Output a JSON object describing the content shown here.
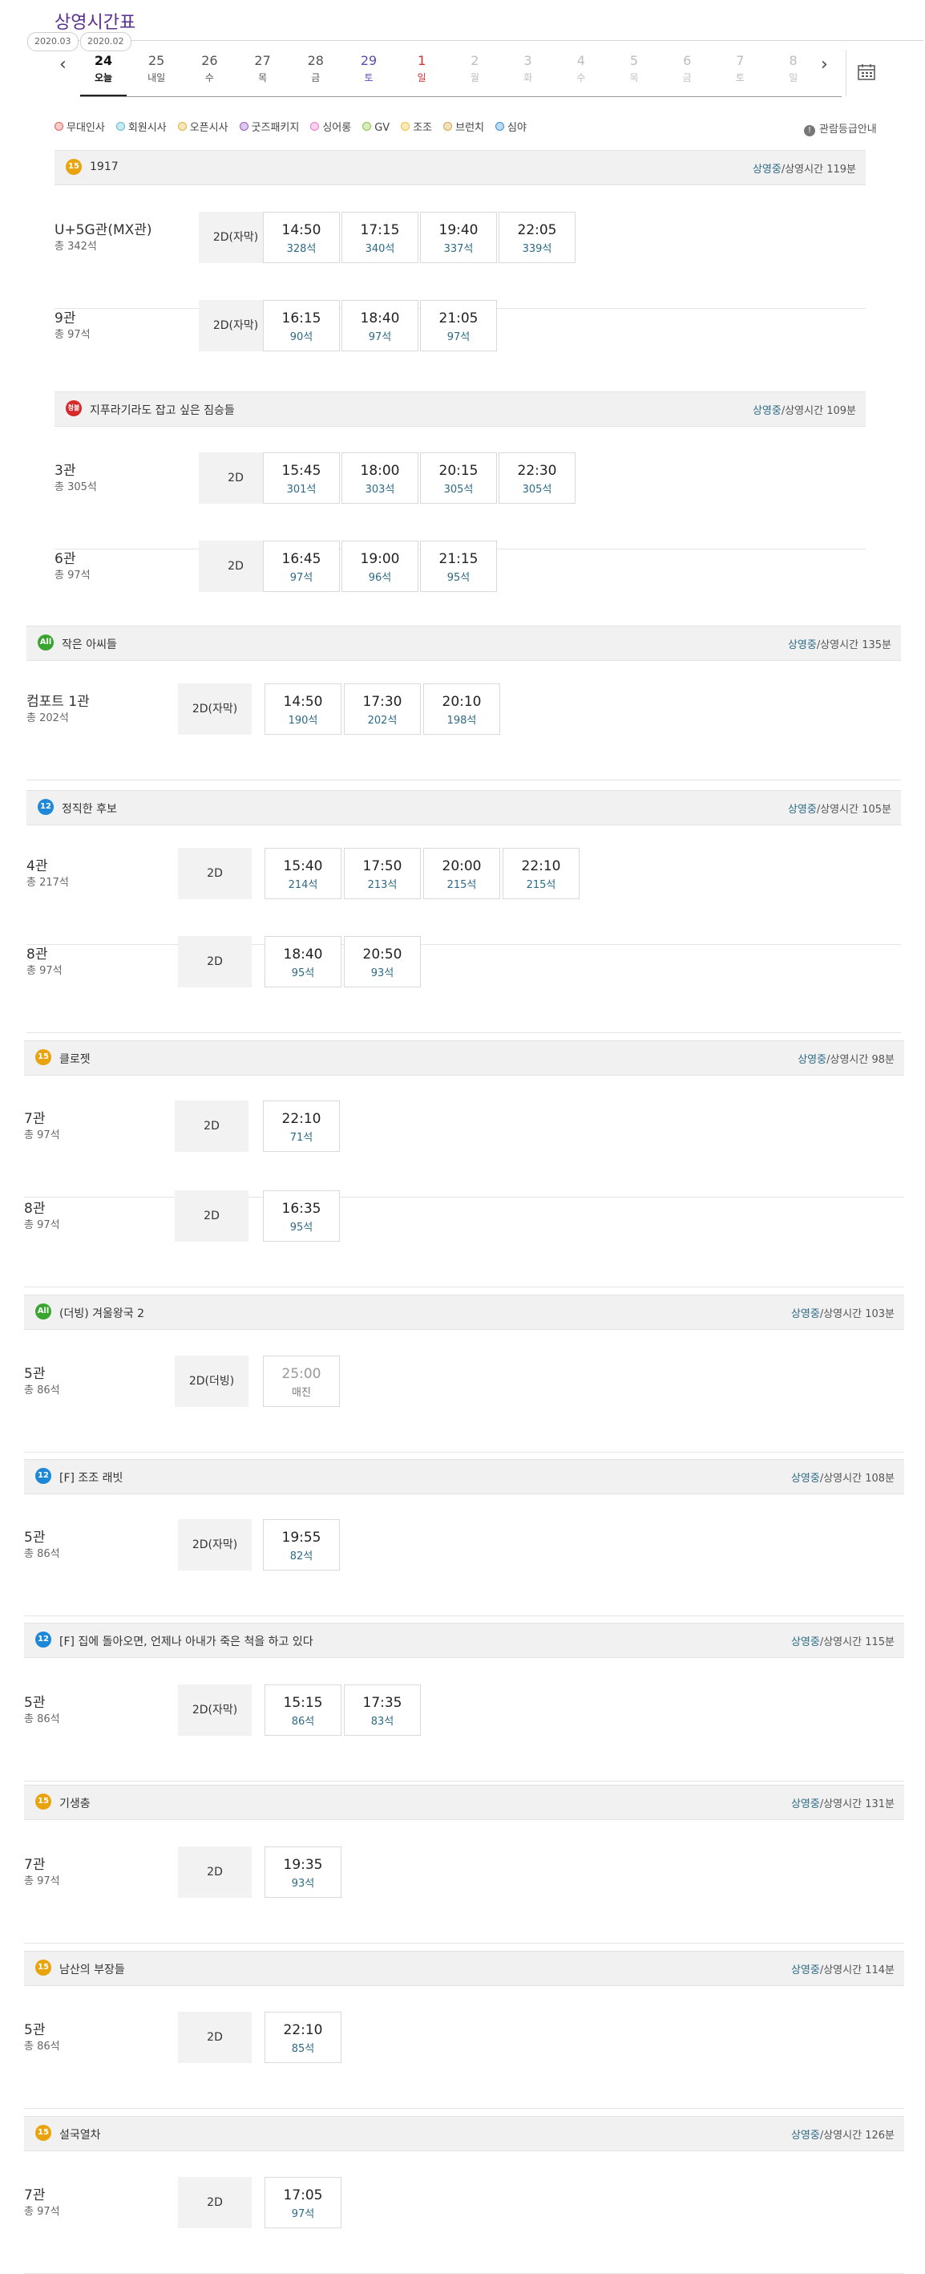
{
  "page_title": "상영시간표",
  "month_tags": [
    "2020.03",
    "2020.02"
  ],
  "days": [
    {
      "num": "24",
      "label": "오늘",
      "color": "#111111"
    },
    {
      "num": "25",
      "label": "내일",
      "color": "#555555"
    },
    {
      "num": "26",
      "label": "수",
      "color": "#555555"
    },
    {
      "num": "27",
      "label": "목",
      "color": "#555555"
    },
    {
      "num": "28",
      "label": "금",
      "color": "#555555"
    },
    {
      "num": "29",
      "label": "토",
      "color": "#5a4db3"
    },
    {
      "num": "1",
      "label": "일",
      "color": "#d12e2e"
    },
    {
      "num": "2",
      "label": "월",
      "color": "#bdbdbd"
    },
    {
      "num": "3",
      "label": "화",
      "color": "#bdbdbd"
    },
    {
      "num": "4",
      "label": "수",
      "color": "#bdbdbd"
    },
    {
      "num": "5",
      "label": "목",
      "color": "#bdbdbd"
    },
    {
      "num": "6",
      "label": "금",
      "color": "#bdbdbd"
    },
    {
      "num": "7",
      "label": "토",
      "color": "#bdbdbd"
    },
    {
      "num": "8",
      "label": "일",
      "color": "#bdbdbd"
    }
  ],
  "legend": [
    {
      "label": "무대인사",
      "color": "#e0655f"
    },
    {
      "label": "회원시사",
      "color": "#5bbcd6"
    },
    {
      "label": "오픈시사",
      "color": "#e0b43c"
    },
    {
      "label": "굿즈패키지",
      "color": "#9a5cc4"
    },
    {
      "label": "싱어롱",
      "color": "#e97bc9"
    },
    {
      "label": "GV",
      "color": "#8cc63f"
    },
    {
      "label": "조조",
      "color": "#f2c037"
    },
    {
      "label": "브런치",
      "color": "#d9a443"
    },
    {
      "label": "심야",
      "color": "#3a8fd6"
    }
  ],
  "rating_guide": "관람등급안내",
  "status_label": "상영중",
  "runtime_prefix": "/상영시간",
  "movies": [
    {
      "rating": "15",
      "title": "1917",
      "runtime": "119분",
      "halls": [
        {
          "name": "U+5G관(MX관)",
          "seats": "총 342석",
          "format": "2D(자막)",
          "slots": [
            {
              "time": "14:50",
              "seats": "328석"
            },
            {
              "time": "17:15",
              "seats": "340석"
            },
            {
              "time": "19:40",
              "seats": "337석"
            },
            {
              "time": "22:05",
              "seats": "339석"
            }
          ]
        },
        {
          "name": "9관",
          "seats": "총 97석",
          "format": "2D(자막)",
          "slots": [
            {
              "time": "16:15",
              "seats": "90석"
            },
            {
              "time": "18:40",
              "seats": "97석"
            },
            {
              "time": "21:05",
              "seats": "97석"
            }
          ]
        }
      ]
    },
    {
      "rating": "청불",
      "title": "지푸라기라도 잡고 싶은 짐승들",
      "runtime": "109분",
      "halls": [
        {
          "name": "3관",
          "seats": "총 305석",
          "format": "2D",
          "slots": [
            {
              "time": "15:45",
              "seats": "301석"
            },
            {
              "time": "18:00",
              "seats": "303석"
            },
            {
              "time": "20:15",
              "seats": "305석"
            },
            {
              "time": "22:30",
              "seats": "305석"
            }
          ]
        },
        {
          "name": "6관",
          "seats": "총 97석",
          "format": "2D",
          "slots": [
            {
              "time": "16:45",
              "seats": "97석"
            },
            {
              "time": "19:00",
              "seats": "96석"
            },
            {
              "time": "21:15",
              "seats": "95석"
            }
          ]
        }
      ]
    },
    {
      "rating": "All",
      "title": "작은 아씨들",
      "runtime": "135분",
      "halls": [
        {
          "name": "컴포트 1관",
          "seats": "총 202석",
          "format": "2D(자막)",
          "slots": [
            {
              "time": "14:50",
              "seats": "190석"
            },
            {
              "time": "17:30",
              "seats": "202석"
            },
            {
              "time": "20:10",
              "seats": "198석"
            }
          ]
        }
      ]
    },
    {
      "rating": "12",
      "title": "정직한 후보",
      "runtime": "105분",
      "halls": [
        {
          "name": "4관",
          "seats": "총 217석",
          "format": "2D",
          "slots": [
            {
              "time": "15:40",
              "seats": "214석"
            },
            {
              "time": "17:50",
              "seats": "213석"
            },
            {
              "time": "20:00",
              "seats": "215석"
            },
            {
              "time": "22:10",
              "seats": "215석"
            }
          ]
        },
        {
          "name": "8관",
          "seats": "총 97석",
          "format": "2D",
          "slots": [
            {
              "time": "18:40",
              "seats": "95석"
            },
            {
              "time": "20:50",
              "seats": "93석"
            }
          ]
        }
      ]
    },
    {
      "rating": "15",
      "title": "클로젯",
      "runtime": "98분",
      "halls": [
        {
          "name": "7관",
          "seats": "총 97석",
          "format": "2D",
          "slots": [
            {
              "time": "22:10",
              "seats": "71석"
            }
          ]
        },
        {
          "name": "8관",
          "seats": "총 97석",
          "format": "2D",
          "slots": [
            {
              "time": "16:35",
              "seats": "95석"
            }
          ]
        }
      ]
    },
    {
      "rating": "All",
      "title": "(더빙) 겨울왕국 2",
      "runtime": "103분",
      "halls": [
        {
          "name": "5관",
          "seats": "총 86석",
          "format": "2D(더빙)",
          "slots": [
            {
              "time": "25:00",
              "seats": "매진",
              "soldout": true
            }
          ]
        }
      ]
    },
    {
      "rating": "12",
      "title": "[F] 조조 래빗",
      "runtime": "108분",
      "halls": [
        {
          "name": "5관",
          "seats": "총 86석",
          "format": "2D(자막)",
          "slots": [
            {
              "time": "19:55",
              "seats": "82석"
            }
          ]
        }
      ]
    },
    {
      "rating": "12",
      "title": "[F] 집에 돌아오면, 언제나 아내가 죽은 척을 하고 있다",
      "runtime": "115분",
      "halls": [
        {
          "name": "5관",
          "seats": "총 86석",
          "format": "2D(자막)",
          "slots": [
            {
              "time": "15:15",
              "seats": "86석"
            },
            {
              "time": "17:35",
              "seats": "83석"
            }
          ]
        }
      ]
    },
    {
      "rating": "15",
      "title": "기생충",
      "runtime": "131분",
      "halls": [
        {
          "name": "7관",
          "seats": "총 97석",
          "format": "2D",
          "slots": [
            {
              "time": "19:35",
              "seats": "93석"
            }
          ]
        }
      ]
    },
    {
      "rating": "15",
      "title": "남산의 부장들",
      "runtime": "114분",
      "halls": [
        {
          "name": "5관",
          "seats": "총 86석",
          "format": "2D",
          "slots": [
            {
              "time": "22:10",
              "seats": "85석"
            }
          ]
        }
      ]
    },
    {
      "rating": "15",
      "title": "설국열차",
      "runtime": "126분",
      "halls": [
        {
          "name": "7관",
          "seats": "총 97석",
          "format": "2D",
          "slots": [
            {
              "time": "17:05",
              "seats": "97석"
            }
          ]
        }
      ]
    }
  ]
}
